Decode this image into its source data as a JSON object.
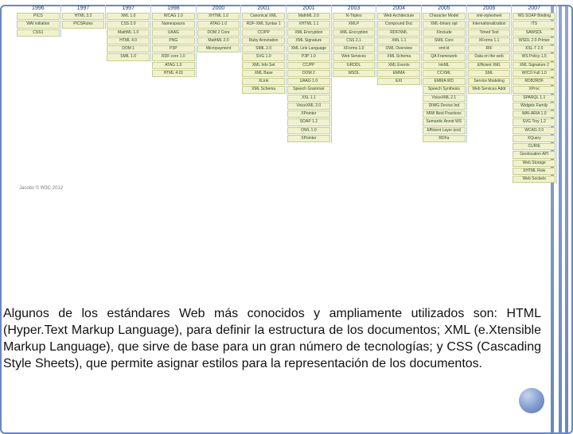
{
  "timeline": {
    "years": [
      "1996",
      "1997",
      "1997",
      "1998",
      "2000",
      "2001",
      "2001",
      "2003",
      "2004",
      "2005",
      "2006",
      "2007"
    ],
    "columns": [
      [
        "PICS",
        "WAI initiation",
        "CSS1"
      ],
      [
        "HTML 3.2",
        "PICSRules"
      ],
      [
        "XML 1.0",
        "CSS 2.0",
        "MathML 1.0",
        "HTML 4.0",
        "DOM 1",
        "SMIL 1.0"
      ],
      [
        "WCAG 1.0",
        "Namespaces",
        "UAAG",
        "PNG",
        "P3P",
        "RDF core 1.0",
        "ATAG 1.0",
        "HTML 4.01"
      ],
      [
        "XHTML 1.0",
        "ATAG 1.0",
        "DOM 2 Core",
        "MathML 2.0",
        "Micropayment"
      ],
      [
        "Canonical XML",
        "RDF-XML Syntax 1",
        "CC/PP",
        "Ruby Annotation",
        "SMIL 2.0",
        "SVG 1.0",
        "XML Info Set",
        "XML Base",
        "XLink",
        "XML Schema"
      ],
      [
        "MathML 2.0",
        "XHTML 1.1",
        "XML Encryption",
        "XML Signature",
        "XML Link Language",
        "P3P 1.0",
        "CC/PP",
        "DOM 2",
        "UAAG 1.0",
        "Speech Grammar",
        "XSL 1.1",
        "VoiceXML 2.0",
        "XPointer",
        "SOAP 1.2",
        "OWL 1.0",
        "XPointer"
      ],
      [
        "N-Triples",
        "XMLP",
        "XML-Encryption",
        "CSS 2.1",
        "XForms 1.0",
        "Web Services",
        "GRDDL",
        "WSDL"
      ],
      [
        "Web Architecture",
        "Compound Doc",
        "RDF/XML",
        "XML 1.1",
        "OWL Overview",
        "XML Schema",
        "XML Events",
        "EMMA",
        "EXI"
      ],
      [
        "Character Model",
        "XML-binary opt",
        "XInclude",
        "SMIL Core",
        "xml:id",
        "QA Framework",
        "InkML",
        "CCXML",
        "EMMA WD",
        "Speech Synthesis",
        "VoiceXML 2.1",
        "DIWG Device Ind",
        "MWI Best Practices",
        "Semantic Annot WS",
        "Efficient Layer (exi)",
        "RDFa"
      ],
      [
        "xml-stylesheet",
        "Internationalization",
        "Timed Text",
        "XForms 1.1",
        "RIF",
        "Data on the web",
        "Efficient XML",
        "SML",
        "Service Modeling",
        "Web Services Addr"
      ],
      [
        "WS SOAP Binding",
        "ITS",
        "SAWSDL",
        "WSDL 2.0 Primer",
        "XSL-T 2.0",
        "WS Policy 1.5",
        "XML Signature 2",
        "WICD Full 1.0",
        "RDB2RDF",
        "XProc",
        "SPARQL 1.1",
        "Widgets Family",
        "WAI-ARIA 1.0",
        "SVG Tiny 1.2",
        "WCAG 2.0",
        "XQuery",
        "CURIE",
        "Geolocation API",
        "Web Storage",
        "XHTML Role",
        "Web Sockets"
      ]
    ],
    "source_caption": "Jacobs   © W3C 2012"
  },
  "paragraph": "Algunos de los estándares Web más conocidos y ampliamente utilizados son: HTML (Hyper.Text Markup Language), para definir la estructura de los documentos; XML (e.Xtensible Markup Language), que sirve de base para un gran número de tecnologías; y CSS (Cascading Style Sheets), que permite asignar estilos para la representación de los documentos.",
  "colors": {
    "accent": "#6a86c2"
  }
}
